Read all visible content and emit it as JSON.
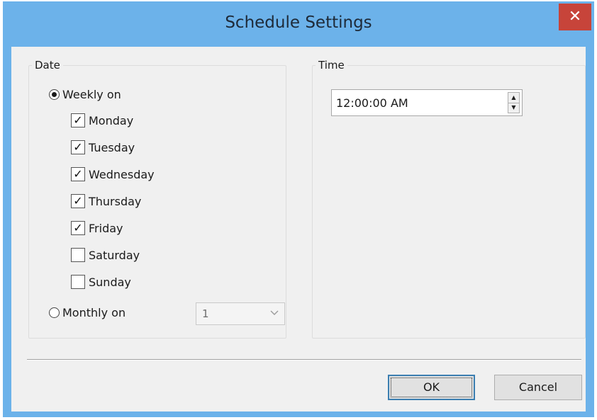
{
  "window": {
    "title": "Schedule Settings",
    "close_glyph": "✕"
  },
  "date_group": {
    "legend": "Date",
    "weekly": {
      "label": "Weekly on",
      "selected": true
    },
    "days": [
      {
        "label": "Monday",
        "checked": true
      },
      {
        "label": "Tuesday",
        "checked": true
      },
      {
        "label": "Wednesday",
        "checked": true
      },
      {
        "label": "Thursday",
        "checked": true
      },
      {
        "label": "Friday",
        "checked": true
      },
      {
        "label": "Saturday",
        "checked": false
      },
      {
        "label": "Sunday",
        "checked": false
      }
    ],
    "monthly": {
      "label": "Monthly on",
      "selected": false
    },
    "monthly_day": {
      "value": "1",
      "icon": "chevron-down-icon"
    }
  },
  "time_group": {
    "legend": "Time",
    "value": "12:00:00 AM"
  },
  "buttons": {
    "ok": "OK",
    "cancel": "Cancel"
  },
  "colors": {
    "titlebar": "#6cb2ea",
    "close": "#c7443a",
    "client": "#f0f0f0"
  }
}
